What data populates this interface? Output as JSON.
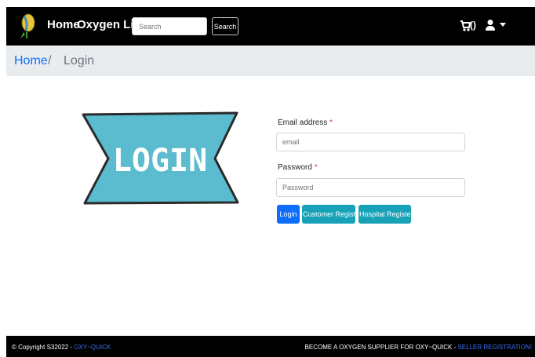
{
  "navbar": {
    "home_label": "Home",
    "oxygen_list_label": "Oxygen List",
    "search": {
      "placeholder": "Search",
      "button_label": "Search"
    },
    "cart_text": "()"
  },
  "breadcrumb": {
    "home": "Home",
    "separator": "/",
    "current": "Login"
  },
  "banner": {
    "text": "LOGIN"
  },
  "form": {
    "email_label": "Email address",
    "email_placeholder": "email",
    "password_label": "Password",
    "password_placeholder": "Password",
    "required_mark": "*",
    "login_button": "Login",
    "customer_register_button": "Customer Register!",
    "hospital_register_button": "Hospital Register!"
  },
  "footer": {
    "copyright": "© Copyright S32022 - ",
    "brand_link": "OXY~QUICK",
    "supplier_text": "BECOME A OXYGEN SUPPLIER FOR OXY~QUICK - ",
    "seller_link": "SELLER REGISTRATION!"
  },
  "colors": {
    "navbar": "#000000",
    "breadcrumb_bg": "#e9ecef",
    "link": "#0d6efd",
    "banner_fill": "#5bbccf",
    "primary": "#0d6efd",
    "info": "#17a2b8",
    "required": "#dc3545"
  }
}
